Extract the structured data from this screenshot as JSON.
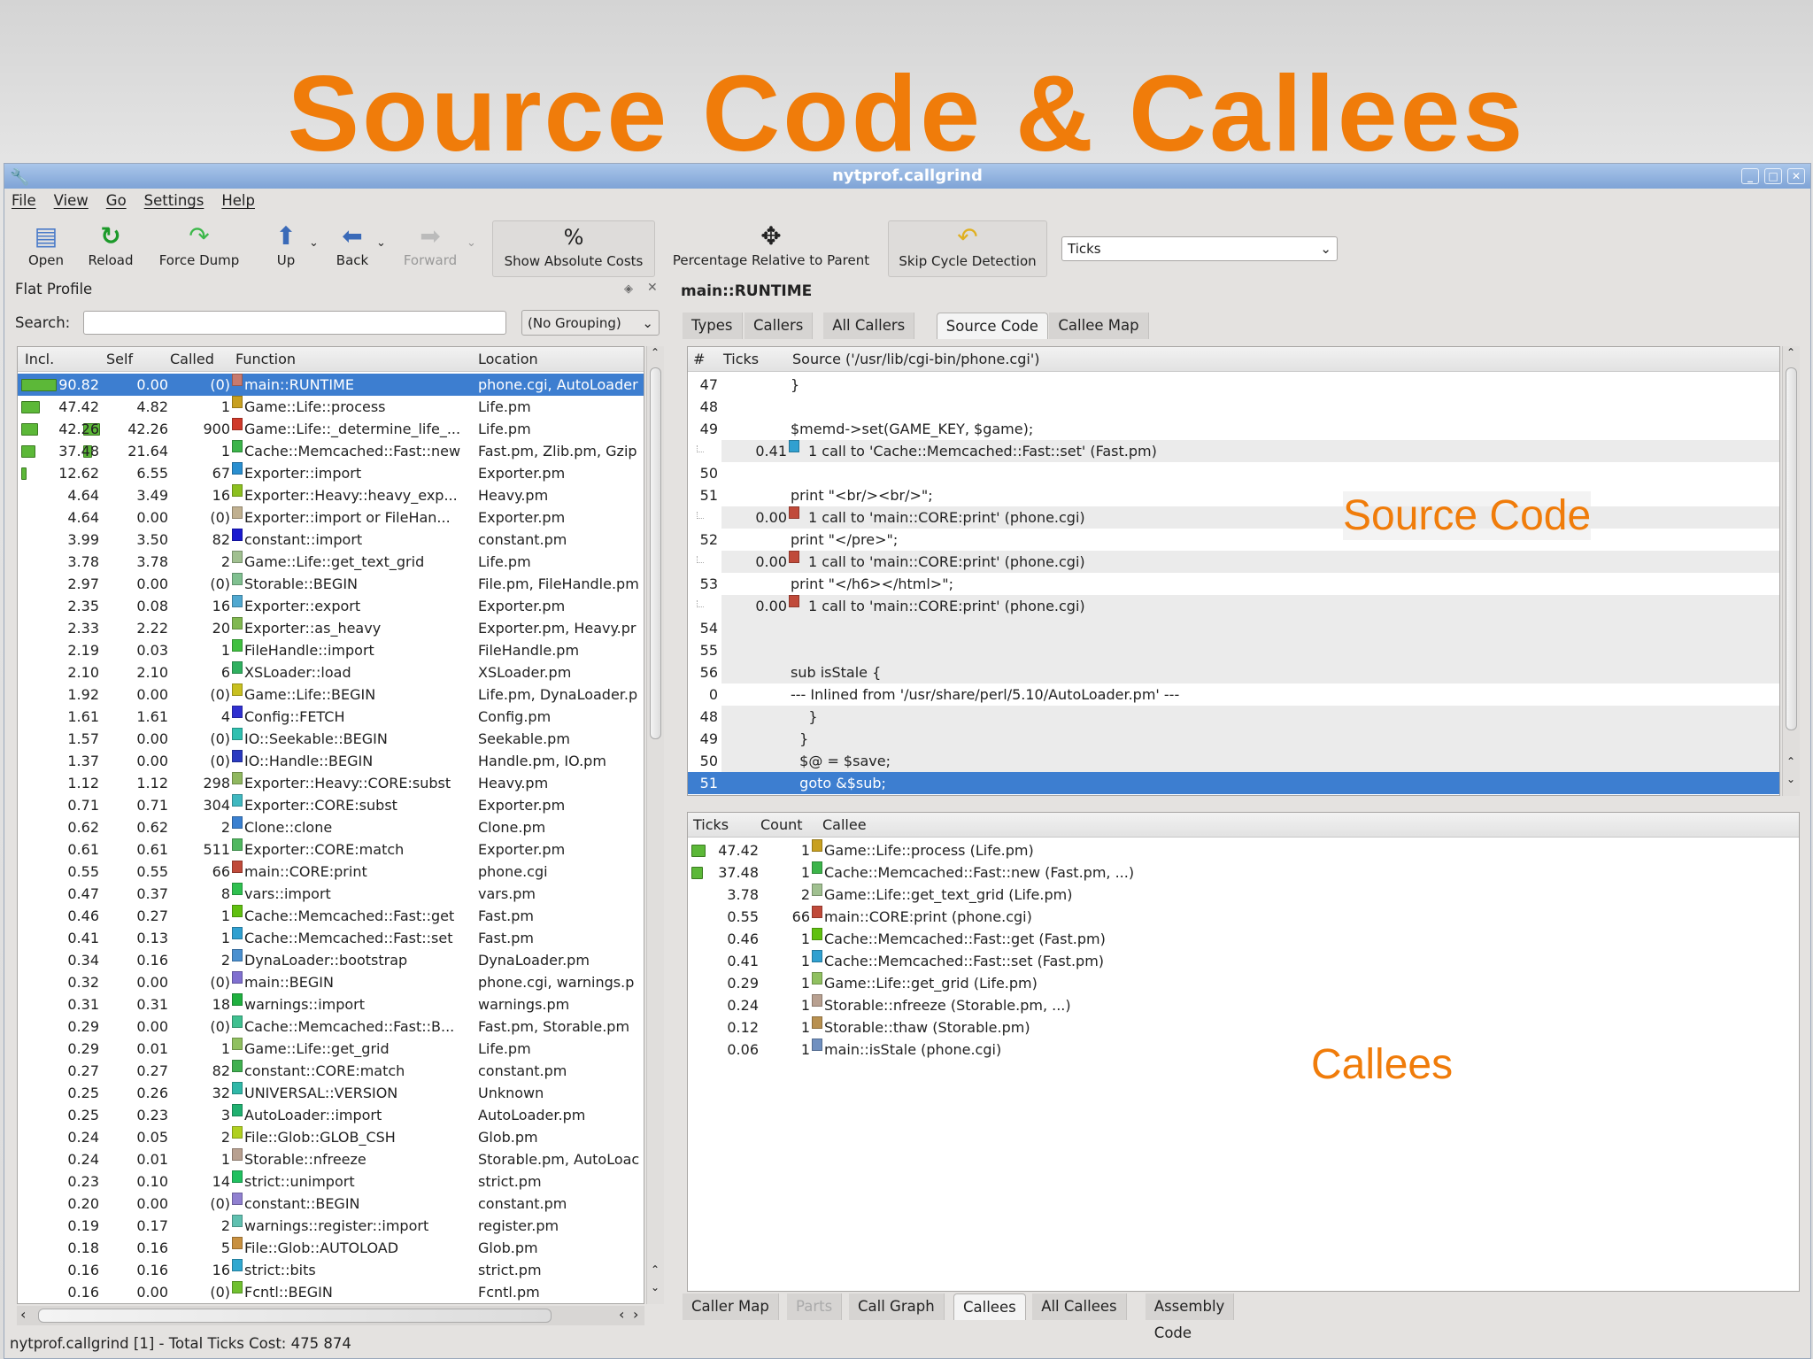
{
  "slide_title": "Source Code & Callees",
  "window": {
    "title": "nytprof.callgrind"
  },
  "menu": [
    "File",
    "View",
    "Go",
    "Settings",
    "Help"
  ],
  "toolbar": {
    "open": "Open",
    "reload": "Reload",
    "force_dump": "Force Dump",
    "up": "Up",
    "back": "Back",
    "forward": "Forward",
    "show_absolute_costs": "Show Absolute Costs",
    "percentage_relative": "Percentage Relative to Parent",
    "skip_cycle": "Skip Cycle Detection",
    "cost_type": "Ticks"
  },
  "flat_profile": {
    "title": "Flat Profile",
    "search_label": "Search:",
    "search_value": "",
    "grouping": "(No Grouping)",
    "columns": [
      "Incl.",
      "Self",
      "Called",
      "Function",
      "Location"
    ],
    "rows": [
      {
        "incl": "90.82",
        "self": "0.00",
        "called": "(0)",
        "color": "#c87a6e",
        "function": "main::RUNTIME",
        "location": "phone.cgi, AutoLoader",
        "selected": true
      },
      {
        "incl": "47.42",
        "self": "4.82",
        "called": "1",
        "color": "#c8a020",
        "function": "Game::Life::process",
        "location": "Life.pm"
      },
      {
        "incl": "42.26",
        "self": "42.26",
        "called": "900",
        "color": "#d03a2a",
        "function": "Game::Life::_determine_life_...",
        "location": "Life.pm"
      },
      {
        "incl": "37.48",
        "self": "21.64",
        "called": "1",
        "color": "#3cb44a",
        "function": "Cache::Memcached::Fast::new",
        "location": "Fast.pm, Zlib.pm, Gzip"
      },
      {
        "incl": "12.62",
        "self": "6.55",
        "called": "67",
        "color": "#2a8fd0",
        "function": "Exporter::import",
        "location": "Exporter.pm"
      },
      {
        "incl": "4.64",
        "self": "3.49",
        "called": "16",
        "color": "#8cc020",
        "function": "Exporter::Heavy::heavy_exp...",
        "location": "Heavy.pm"
      },
      {
        "incl": "4.64",
        "self": "0.00",
        "called": "(0)",
        "color": "#c0b090",
        "function": "Exporter::import or FileHan...",
        "location": "Exporter.pm"
      },
      {
        "incl": "3.99",
        "self": "3.50",
        "called": "82",
        "color": "#1a1ad0",
        "function": "constant::import",
        "location": "constant.pm"
      },
      {
        "incl": "3.78",
        "self": "3.78",
        "called": "2",
        "color": "#a0c090",
        "function": "Game::Life::get_text_grid",
        "location": "Life.pm"
      },
      {
        "incl": "2.97",
        "self": "0.00",
        "called": "(0)",
        "color": "#80c090",
        "function": "Storable::BEGIN",
        "location": "File.pm, FileHandle.pm"
      },
      {
        "incl": "2.35",
        "self": "0.08",
        "called": "16",
        "color": "#50a8d0",
        "function": "Exporter::export",
        "location": "Exporter.pm"
      },
      {
        "incl": "2.33",
        "self": "2.22",
        "called": "20",
        "color": "#80b850",
        "function": "Exporter::as_heavy",
        "location": "Exporter.pm, Heavy.pr"
      },
      {
        "incl": "2.19",
        "self": "0.03",
        "called": "1",
        "color": "#40c040",
        "function": "FileHandle::import",
        "location": "FileHandle.pm"
      },
      {
        "incl": "2.10",
        "self": "2.10",
        "called": "6",
        "color": "#30b060",
        "function": "XSLoader::load",
        "location": "XSLoader.pm"
      },
      {
        "incl": "1.92",
        "self": "0.00",
        "called": "(0)",
        "color": "#c8c020",
        "function": "Game::Life::BEGIN",
        "location": "Life.pm, DynaLoader.p"
      },
      {
        "incl": "1.61",
        "self": "1.61",
        "called": "4",
        "color": "#3030d0",
        "function": "Config::FETCH",
        "location": "Config.pm"
      },
      {
        "incl": "1.57",
        "self": "0.00",
        "called": "(0)",
        "color": "#30c0b0",
        "function": "IO::Seekable::BEGIN",
        "location": "Seekable.pm"
      },
      {
        "incl": "1.37",
        "self": "0.00",
        "called": "(0)",
        "color": "#2a3ac0",
        "function": "IO::Handle::BEGIN",
        "location": "Handle.pm, IO.pm"
      },
      {
        "incl": "1.12",
        "self": "1.12",
        "called": "298",
        "color": "#90b860",
        "function": "Exporter::Heavy::CORE:subst",
        "location": "Heavy.pm"
      },
      {
        "incl": "0.71",
        "self": "0.71",
        "called": "304",
        "color": "#40b8c0",
        "function": "Exporter::CORE:subst",
        "location": "Exporter.pm"
      },
      {
        "incl": "0.62",
        "self": "0.62",
        "called": "2",
        "color": "#3a80d0",
        "function": "Clone::clone",
        "location": "Clone.pm"
      },
      {
        "incl": "0.61",
        "self": "0.61",
        "called": "511",
        "color": "#50b860",
        "function": "Exporter::CORE:match",
        "location": "Exporter.pm"
      },
      {
        "incl": "0.55",
        "self": "0.55",
        "called": "66",
        "color": "#c04a3a",
        "function": "main::CORE:print",
        "location": "phone.cgi"
      },
      {
        "incl": "0.47",
        "self": "0.37",
        "called": "8",
        "color": "#30c050",
        "function": "vars::import",
        "location": "vars.pm"
      },
      {
        "incl": "0.46",
        "self": "0.27",
        "called": "1",
        "color": "#60c010",
        "function": "Cache::Memcached::Fast::get",
        "location": "Fast.pm"
      },
      {
        "incl": "0.41",
        "self": "0.13",
        "called": "1",
        "color": "#30a0d0",
        "function": "Cache::Memcached::Fast::set",
        "location": "Fast.pm"
      },
      {
        "incl": "0.34",
        "self": "0.16",
        "called": "2",
        "color": "#4a90d0",
        "function": "DynaLoader::bootstrap",
        "location": "DynaLoader.pm"
      },
      {
        "incl": "0.32",
        "self": "0.00",
        "called": "(0)",
        "color": "#8070d0",
        "function": "main::BEGIN",
        "location": "phone.cgi, warnings.p"
      },
      {
        "incl": "0.31",
        "self": "0.31",
        "called": "18",
        "color": "#20b040",
        "function": "warnings::import",
        "location": "warnings.pm"
      },
      {
        "incl": "0.29",
        "self": "0.00",
        "called": "(0)",
        "color": "#40c090",
        "function": "Cache::Memcached::Fast::B...",
        "location": "Fast.pm, Storable.pm"
      },
      {
        "incl": "0.29",
        "self": "0.01",
        "called": "1",
        "color": "#90c060",
        "function": "Game::Life::get_grid",
        "location": "Life.pm"
      },
      {
        "incl": "0.27",
        "self": "0.27",
        "called": "82",
        "color": "#40b050",
        "function": "constant::CORE:match",
        "location": "constant.pm"
      },
      {
        "incl": "0.25",
        "self": "0.26",
        "called": "32",
        "color": "#30b8a8",
        "function": "UNIVERSAL::VERSION",
        "location": "Unknown"
      },
      {
        "incl": "0.25",
        "self": "0.23",
        "called": "3",
        "color": "#20b070",
        "function": "AutoLoader::import",
        "location": "AutoLoader.pm"
      },
      {
        "incl": "0.24",
        "self": "0.05",
        "called": "2",
        "color": "#b0d020",
        "function": "File::Glob::GLOB_CSH",
        "location": "Glob.pm"
      },
      {
        "incl": "0.24",
        "self": "0.01",
        "called": "1",
        "color": "#b8a090",
        "function": "Storable::nfreeze",
        "location": "Storable.pm, AutoLoac"
      },
      {
        "incl": "0.23",
        "self": "0.10",
        "called": "14",
        "color": "#20c060",
        "function": "strict::unimport",
        "location": "strict.pm"
      },
      {
        "incl": "0.20",
        "self": "0.00",
        "called": "(0)",
        "color": "#9080d0",
        "function": "constant::BEGIN",
        "location": "constant.pm"
      },
      {
        "incl": "0.19",
        "self": "0.17",
        "called": "2",
        "color": "#60c0b0",
        "function": "warnings::register::import",
        "location": "register.pm"
      },
      {
        "incl": "0.18",
        "self": "0.16",
        "called": "5",
        "color": "#c89040",
        "function": "File::Glob::AUTOLOAD",
        "location": "Glob.pm"
      },
      {
        "incl": "0.16",
        "self": "0.16",
        "called": "16",
        "color": "#30a8d0",
        "function": "strict::bits",
        "location": "strict.pm"
      },
      {
        "incl": "0.16",
        "self": "0.00",
        "called": "(0)",
        "color": "#70c030",
        "function": "Fcntl::BEGIN",
        "location": "Fcntl.pm"
      }
    ]
  },
  "status": "nytprof.callgrind [1] - Total Ticks Cost:  475 874",
  "detail": {
    "function_name": "main::RUNTIME",
    "top_tabs": [
      {
        "label": "Types"
      },
      {
        "label": "Callers"
      },
      {
        "label": "All Callers"
      },
      {
        "label": "Source Code",
        "active": true
      },
      {
        "label": "Callee Map"
      }
    ],
    "source": {
      "columns": [
        "#",
        "Ticks",
        "Source ('/usr/lib/cgi-bin/phone.cgi')"
      ],
      "rows": [
        {
          "num": "47",
          "ticks": "",
          "text": "}",
          "kind": "code"
        },
        {
          "num": "48",
          "ticks": "",
          "text": "",
          "kind": "code"
        },
        {
          "num": "49",
          "ticks": "",
          "text": "$memd->set(GAME_KEY, $game);",
          "kind": "code"
        },
        {
          "num": "",
          "ticks": "0.41",
          "color": "#30a0d0",
          "text": "1 call to 'Cache::Memcached::Fast::set' (Fast.pm)",
          "kind": "call"
        },
        {
          "num": "50",
          "ticks": "",
          "text": "",
          "kind": "code"
        },
        {
          "num": "51",
          "ticks": "",
          "text": "print \"<br/><br/>\";",
          "kind": "code"
        },
        {
          "num": "",
          "ticks": "0.00",
          "color": "#c04a3a",
          "text": "1 call to 'main::CORE:print' (phone.cgi)",
          "kind": "call"
        },
        {
          "num": "52",
          "ticks": "",
          "text": "print \"</pre>\";",
          "kind": "code"
        },
        {
          "num": "",
          "ticks": "0.00",
          "color": "#c04a3a",
          "text": "1 call to 'main::CORE:print' (phone.cgi)",
          "kind": "call"
        },
        {
          "num": "53",
          "ticks": "",
          "text": "print \"</h6></html>\";",
          "kind": "code"
        },
        {
          "num": "",
          "ticks": "0.00",
          "color": "#c04a3a",
          "text": "1 call to 'main::CORE:print' (phone.cgi)",
          "kind": "call"
        },
        {
          "num": "54",
          "ticks": "",
          "text": "",
          "kind": "grey"
        },
        {
          "num": "55",
          "ticks": "",
          "text": "",
          "kind": "grey"
        },
        {
          "num": "56",
          "ticks": "",
          "text": "sub isStale {",
          "kind": "grey"
        },
        {
          "num": "0",
          "ticks": "",
          "text": "--- Inlined from '/usr/share/perl/5.10/AutoLoader.pm' ---",
          "kind": "inlined"
        },
        {
          "num": "48",
          "ticks": "",
          "text": "    }",
          "kind": "grey"
        },
        {
          "num": "49",
          "ticks": "",
          "text": "  }",
          "kind": "grey"
        },
        {
          "num": "50",
          "ticks": "",
          "text": "  $@ = $save;",
          "kind": "grey"
        },
        {
          "num": "51",
          "ticks": "",
          "text": "  goto &$sub;",
          "kind": "selected"
        }
      ]
    },
    "callees": {
      "columns": [
        "Ticks",
        "Count",
        "Callee"
      ],
      "rows": [
        {
          "ticks": "47.42",
          "count": "1",
          "color": "#c8a020",
          "callee": "Game::Life::process (Life.pm)"
        },
        {
          "ticks": "37.48",
          "count": "1",
          "color": "#3cb44a",
          "callee": "Cache::Memcached::Fast::new (Fast.pm, ...)"
        },
        {
          "ticks": "3.78",
          "count": "2",
          "color": "#a0c090",
          "callee": "Game::Life::get_text_grid (Life.pm)"
        },
        {
          "ticks": "0.55",
          "count": "66",
          "color": "#c04a3a",
          "callee": "main::CORE:print (phone.cgi)"
        },
        {
          "ticks": "0.46",
          "count": "1",
          "color": "#60c010",
          "callee": "Cache::Memcached::Fast::get (Fast.pm)"
        },
        {
          "ticks": "0.41",
          "count": "1",
          "color": "#30a0d0",
          "callee": "Cache::Memcached::Fast::set (Fast.pm)"
        },
        {
          "ticks": "0.29",
          "count": "1",
          "color": "#90c060",
          "callee": "Game::Life::get_grid (Life.pm)"
        },
        {
          "ticks": "0.24",
          "count": "1",
          "color": "#b8a090",
          "callee": "Storable::nfreeze (Storable.pm, ...)"
        },
        {
          "ticks": "0.12",
          "count": "1",
          "color": "#b89050",
          "callee": "Storable::thaw (Storable.pm)"
        },
        {
          "ticks": "0.06",
          "count": "1",
          "color": "#7090c0",
          "callee": "main::isStale (phone.cgi)"
        }
      ]
    },
    "bottom_tabs": [
      {
        "label": "Caller Map"
      },
      {
        "label": "Parts",
        "disabled": true
      },
      {
        "label": "Call Graph"
      },
      {
        "label": "Callees",
        "active": true
      },
      {
        "label": "All Callees"
      },
      {
        "label": "Assembly Code"
      }
    ]
  },
  "annotations": {
    "source_code": "Source Code",
    "callees": "Callees"
  }
}
